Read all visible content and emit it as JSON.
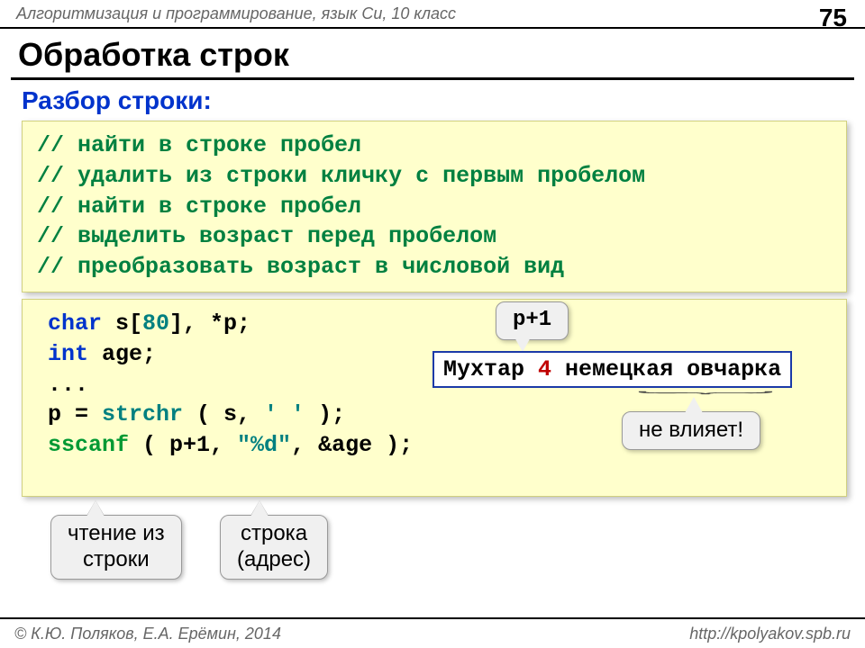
{
  "header": {
    "course": "Алгоритмизация и программирование, язык Си, 10 класс",
    "page": "75"
  },
  "title": "Обработка строк",
  "subtitle": "Разбор строки:",
  "comments_block": "// найти в строке пробел\n// удалить из строки кличку с первым пробелом\n// найти в строке пробел\n// выделить возраст перед пробелом\n// преобразовать возраст в числовой вид",
  "code": {
    "line1_kw": "char",
    "line1_rest": " s[",
    "line1_num": "80",
    "line1_tail": "], *p;",
    "line2_kw": "int",
    "line2_rest": " age;",
    "line3": "...",
    "line4_a": "p = ",
    "line4_fn": "strchr",
    "line4_b": " ( s, ",
    "line4_lit": "' '",
    "line4_c": " );",
    "line5_fn": "sscanf",
    "line5_a": " ( p+1, ",
    "line5_lit": "\"%d\"",
    "line5_b": ", &age );"
  },
  "callouts": {
    "p1": "p+1",
    "sample_pre": "Мухтар ",
    "sample_hl": "4",
    "sample_post": " немецкая овчарка",
    "ignore": "не влияет!",
    "read": "чтение из\nстроки",
    "addr": "строка\n(адрес)"
  },
  "footer": {
    "authors": "К.Ю. Поляков, Е.А. Ерёмин, 2014",
    "url": "http://kpolyakov.spb.ru"
  }
}
